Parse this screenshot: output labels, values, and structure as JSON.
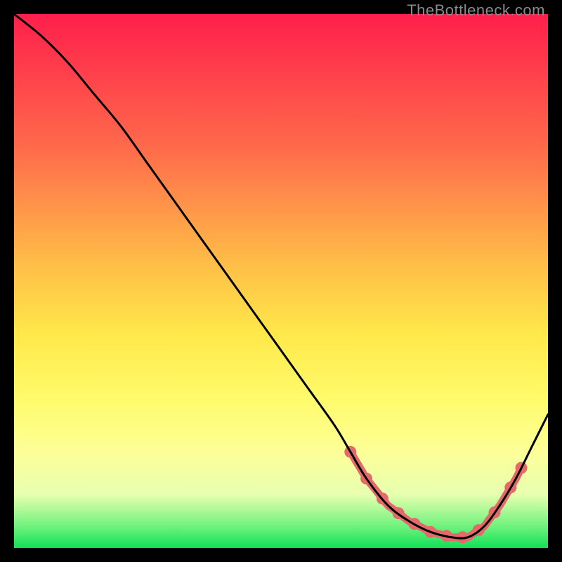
{
  "attribution": "TheBottleneck.com",
  "chart_data": {
    "type": "line",
    "title": "",
    "xlabel": "",
    "ylabel": "",
    "xlim": [
      0,
      100
    ],
    "ylim": [
      0,
      100
    ],
    "series": [
      {
        "name": "curve",
        "x": [
          0,
          5,
          10,
          15,
          20,
          25,
          30,
          35,
          40,
          45,
          50,
          55,
          60,
          63,
          66,
          70,
          74,
          78,
          82,
          85,
          88,
          91,
          94,
          97,
          100
        ],
        "y": [
          100,
          96,
          91,
          85,
          79,
          72,
          65,
          58,
          51,
          44,
          37,
          30,
          23,
          18,
          13,
          8,
          5,
          3,
          2,
          2,
          4,
          8,
          13,
          19,
          25
        ]
      }
    ],
    "highlight_range_x": [
      63,
      95
    ],
    "highlight_points_x": [
      63,
      66,
      69,
      72,
      75,
      78,
      81,
      84,
      87,
      90,
      93,
      95
    ],
    "gradient_stops": [
      {
        "pos": 0.0,
        "color": "#ff1f4b"
      },
      {
        "pos": 0.25,
        "color": "#ff6a4b"
      },
      {
        "pos": 0.48,
        "color": "#ffc247"
      },
      {
        "pos": 0.6,
        "color": "#ffe84a"
      },
      {
        "pos": 0.72,
        "color": "#fffb6a"
      },
      {
        "pos": 0.82,
        "color": "#fdff98"
      },
      {
        "pos": 0.9,
        "color": "#e7ffb0"
      },
      {
        "pos": 0.96,
        "color": "#6ef27d"
      },
      {
        "pos": 1.0,
        "color": "#11e057"
      }
    ]
  }
}
